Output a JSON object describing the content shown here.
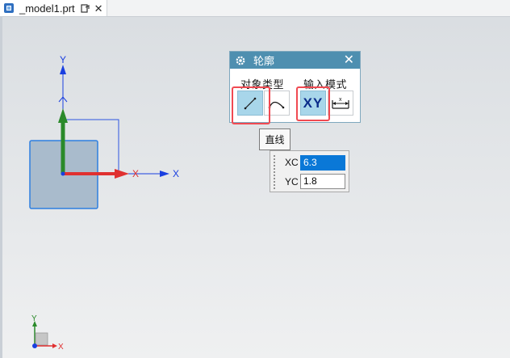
{
  "tab": {
    "filename": "_model1.prt",
    "close": "✕"
  },
  "panel": {
    "title": "轮廓",
    "close": "✕",
    "object_type_label": "对象类型",
    "input_mode_label": "输入模式",
    "buttons": {
      "line": "line-icon",
      "arc": "arc-icon",
      "xy": "XY",
      "parameter": "parameter-mode-icon"
    }
  },
  "tooltip": {
    "text": "直线"
  },
  "coord_input": {
    "xc_label": "XC",
    "xc_value": "6.3",
    "yc_label": "YC",
    "yc_value": "1.8"
  },
  "axes": {
    "y_label": "Y",
    "x_label": "X",
    "x_red_label": "X"
  },
  "triad": {
    "y": "Y",
    "x": "X"
  },
  "colors": {
    "panel_header": "#4e8fb0",
    "selected_button": "#a8d6ea",
    "highlight_box": "#f04a52",
    "active_field": "#0a78d7",
    "axis_blue": "#1a3fe0",
    "axis_green": "#2a8a2a",
    "axis_red": "#e03030"
  }
}
